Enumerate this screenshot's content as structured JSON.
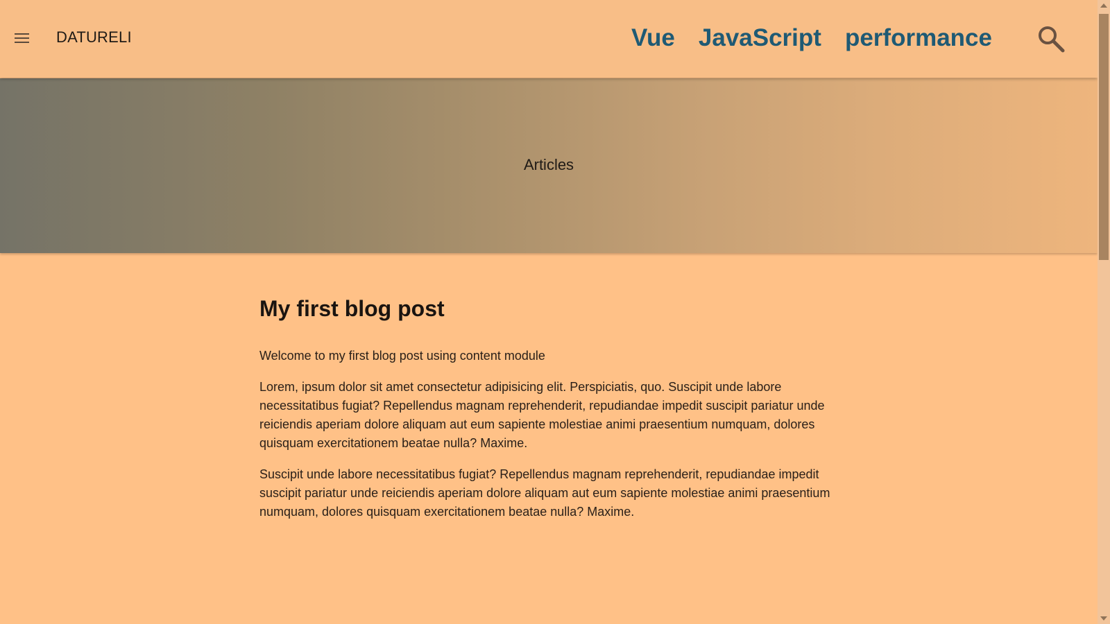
{
  "header": {
    "brand": "DATURELI",
    "nav": [
      "Vue",
      "JavaScript",
      "performance"
    ],
    "menu_icon": "hamburger-menu-icon",
    "search_icon": "search-icon"
  },
  "hero": {
    "title": "Articles"
  },
  "post": {
    "title": "My first blog post",
    "paragraphs": [
      "Welcome to my first blog post using content module",
      "Lorem, ipsum dolor sit amet consectetur adipisicing elit. Perspiciatis, quo. Suscipit unde labore necessitatibus fugiat? Repellendus magnam reprehenderit, repudiandae impedit suscipit pariatur unde reiciendis aperiam dolore aliquam aut eum sapiente molestiae animi praesentium numquam, dolores quisquam exercitationem beatae nulla? Maxime.",
      "Suscipit unde labore necessitatibus fugiat? Repellendus magnam reprehenderit, repudiandae impedit suscipit pariatur unde reiciendis aperiam dolore aliquam aut eum sapiente molestiae animi praesentium numquam, dolores quisquam exercitationem beatae nulla? Maxime."
    ]
  },
  "colors": {
    "page_background": "#ffc187",
    "app_bar": "#f8be87",
    "nav_link": "#1f5a74",
    "text": "#2a2019"
  }
}
